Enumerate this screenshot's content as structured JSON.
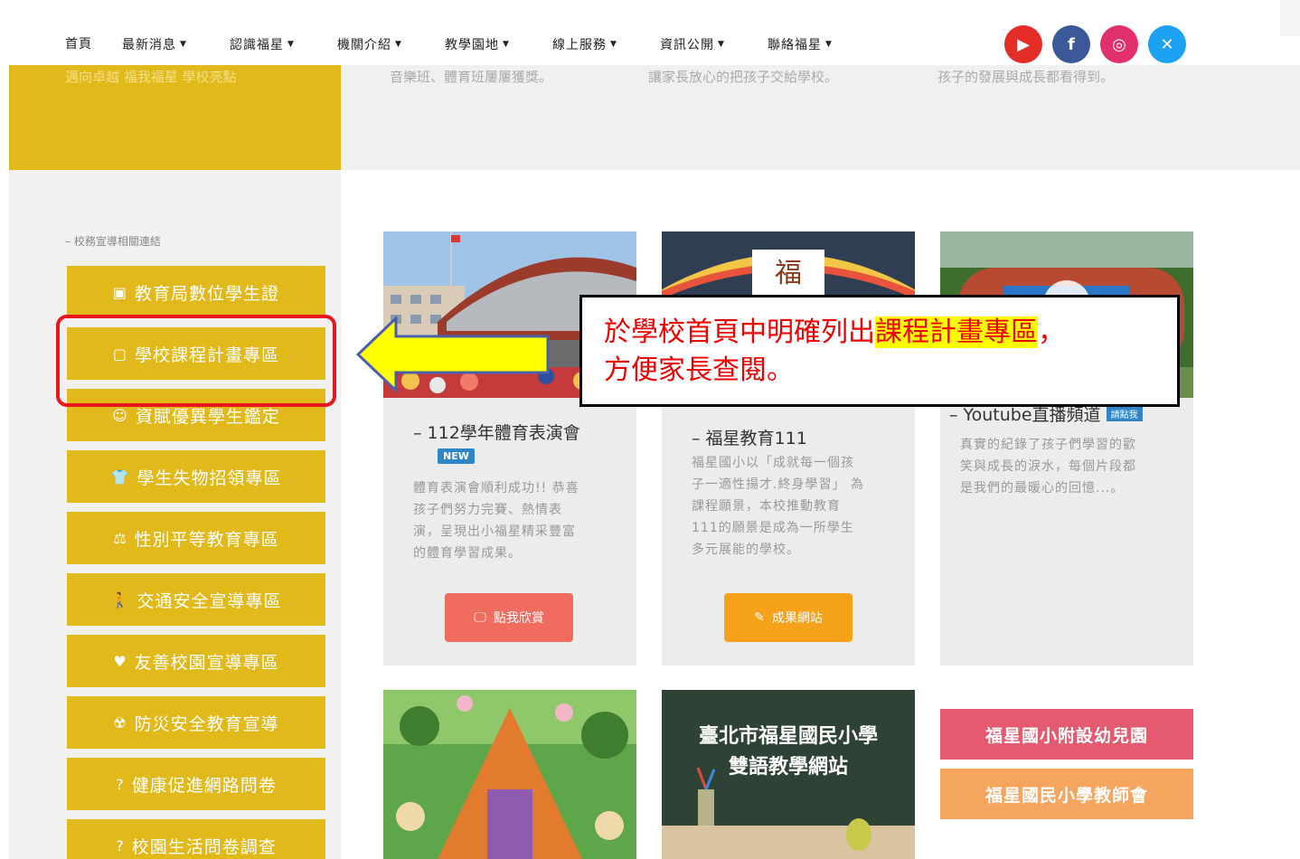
{
  "nav": {
    "items": [
      {
        "label": "首頁",
        "caret": ""
      },
      {
        "label": "最新消息",
        "caret": "▼"
      },
      {
        "label": "認識福星",
        "caret": "▼"
      },
      {
        "label": "機關介紹",
        "caret": "▼"
      },
      {
        "label": "教學園地",
        "caret": "▼"
      },
      {
        "label": "線上服務",
        "caret": "▼"
      },
      {
        "label": "資訊公開",
        "caret": "▼"
      },
      {
        "label": "聯絡福星",
        "caret": "▼"
      }
    ],
    "social": [
      {
        "name": "youtube-icon",
        "glyph": "▶",
        "color": "#e52d27"
      },
      {
        "name": "facebook-icon",
        "glyph": "f",
        "color": "#3b5998"
      },
      {
        "name": "instagram-icon",
        "glyph": "◎",
        "color": "#e1306c"
      },
      {
        "name": "twitter-icon",
        "glyph": "✕",
        "color": "#1da1f2"
      }
    ]
  },
  "hero": {
    "left_text": "邁向卓越 福我福星 學校亮點",
    "right_texts": [
      "音樂班、體育班屢屢獲獎。",
      "讓家長放心的把孩子交給學校。",
      "孩子的發展與成長都看得到。"
    ]
  },
  "sidebar": {
    "heading": "– 校務宣導相關連結",
    "items": [
      {
        "icon": "▣",
        "icon_name": "id-card-icon",
        "label": "教育局數位學生證"
      },
      {
        "icon": "▢",
        "icon_name": "square-icon",
        "label": "學校課程計畫專區"
      },
      {
        "icon": "☺",
        "icon_name": "smile-icon",
        "label": "資賦優異學生鑑定"
      },
      {
        "icon": "👕",
        "icon_name": "shirt-icon",
        "label": "學生失物招領專區"
      },
      {
        "icon": "⚖",
        "icon_name": "balance-icon",
        "label": "性別平等教育專區"
      },
      {
        "icon": "🚶",
        "icon_name": "walking-icon",
        "label": "交通安全宣導專區"
      },
      {
        "icon": "♥",
        "icon_name": "heart-icon",
        "label": "友善校園宣導專區"
      },
      {
        "icon": "☢",
        "icon_name": "radiation-icon",
        "label": "防災安全教育宣導"
      },
      {
        "icon": "?",
        "icon_name": "question-icon",
        "label": "健康促進網路問卷"
      },
      {
        "icon": "?",
        "icon_name": "question-icon",
        "label": "校園生活問卷調查"
      }
    ]
  },
  "cards": [
    {
      "title": "– 112學年體育表演會",
      "badge": "NEW",
      "desc": [
        "體育表演會順利成功!! 恭喜",
        "孩子們努力完賽、熱情表",
        "演，呈現出小福星精采豐富",
        "的體育學習成果。"
      ],
      "button": "點我欣賞",
      "button_icon": "🖵",
      "button_color": "#ef6c5e"
    },
    {
      "title": "– 福星教育111",
      "desc": [
        "福星國小以「成就每一個孩",
        "子一適性揚才.終身學習」 為",
        "課程願景，本校推動教育",
        "111的願景是成為一所學生",
        "多元展能的學校。"
      ],
      "button": "成果網站",
      "button_icon": "✎",
      "button_color": "#f5a11a"
    },
    {
      "title": "– Youtube直播頻道",
      "badge": "請點我",
      "desc": [
        "真實的紀錄了孩子們學習的歡",
        "笑與成長的淚水，每個片段都",
        "是我們的最暖心的回憶...。"
      ]
    }
  ],
  "callout": {
    "line1_prefix": "於學校首頁中明確列出",
    "line1_highlight": "課程計畫專區",
    "line1_suffix": "，",
    "line2": "方便家長查閱。"
  },
  "bottom": {
    "bilingual_line1": "臺北市福星國民小學",
    "bilingual_line2": "雙語教學網站",
    "links": [
      {
        "label": "福星國小附設幼兒園",
        "color": "#e45a6f"
      },
      {
        "label": "福星國民小學教師會",
        "color": "#f6a55e"
      }
    ]
  }
}
